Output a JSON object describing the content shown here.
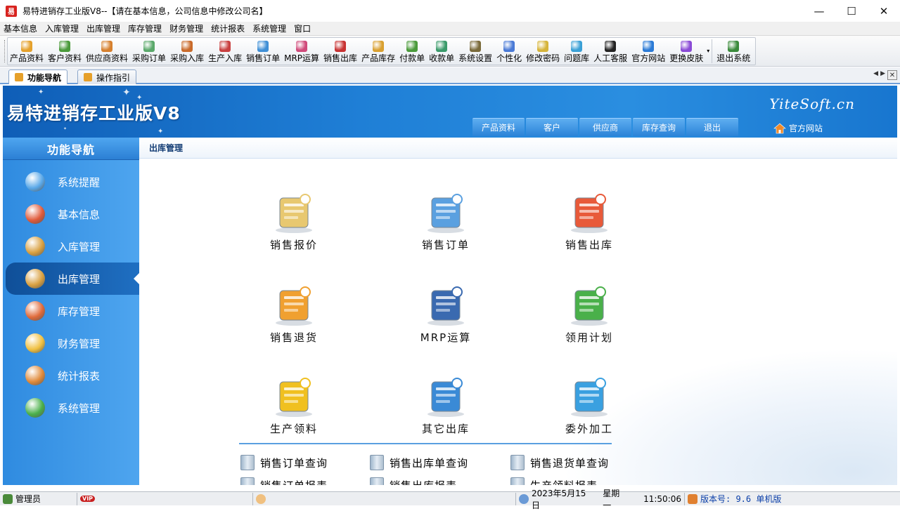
{
  "window": {
    "app_icon_text": "易",
    "title": "易特进销存工业版V8--【请在基本信息，公司信息中修改公司名】",
    "controls": [
      "—",
      "☐",
      "✕"
    ]
  },
  "menu": [
    "基本信息",
    "入库管理",
    "出库管理",
    "库存管理",
    "财务管理",
    "统计报表",
    "系统管理",
    "窗口"
  ],
  "toolbar": [
    {
      "label": "产品资料",
      "icon": "product-box-icon",
      "color": "#e5a12c"
    },
    {
      "label": "客户资料",
      "icon": "customer-icon",
      "color": "#4a9a3a"
    },
    {
      "label": "供应商资料",
      "icon": "supplier-icon",
      "color": "#d6802e"
    },
    {
      "label": "采购订单",
      "icon": "purchase-order-icon",
      "color": "#5aa86a"
    },
    {
      "label": "采购入库",
      "icon": "purchase-stock-in-icon",
      "color": "#c96a2a"
    },
    {
      "label": "生产入库",
      "icon": "production-stock-in-icon",
      "color": "#c94040"
    },
    {
      "label": "销售订单",
      "icon": "sales-order-icon",
      "color": "#3f8fd6"
    },
    {
      "label": "MRP运算",
      "icon": "mrp-calc-icon",
      "color": "#d04a7a"
    },
    {
      "label": "销售出库",
      "icon": "sales-stock-out-icon",
      "color": "#c83232"
    },
    {
      "label": "产品库存",
      "icon": "inventory-icon",
      "color": "#d9a030"
    },
    {
      "label": "付款单",
      "icon": "payment-icon",
      "color": "#4a9a3a"
    },
    {
      "label": "收款单",
      "icon": "receipt-icon",
      "color": "#3a9a6a"
    },
    {
      "label": "系统设置",
      "icon": "settings-icon",
      "color": "#7a6a3a"
    },
    {
      "label": "个性化",
      "icon": "personalize-icon",
      "color": "#4a7ad6"
    },
    {
      "label": "修改密码",
      "icon": "password-icon",
      "color": "#d6b43a"
    },
    {
      "label": "问题库",
      "icon": "faq-icon",
      "color": "#3aa0d6"
    },
    {
      "label": "人工客服",
      "icon": "qq-service-icon",
      "color": "#222222"
    },
    {
      "label": "官方网站",
      "icon": "ie-browser-icon",
      "color": "#2a7ad6"
    },
    {
      "label": "更换皮肤",
      "icon": "skin-icon",
      "color": "#8a4ad6"
    },
    {
      "label": "退出系统",
      "icon": "exit-icon",
      "color": "#3a8a3a"
    }
  ],
  "tabs": [
    {
      "label": "功能导航",
      "active": true
    },
    {
      "label": "操作指引",
      "active": false
    }
  ],
  "banner": {
    "brand": "易特进销存工业版V8",
    "site_name": "YiteSoft.cn",
    "nav_buttons": [
      "产品资料",
      "客户",
      "供应商",
      "库存查询",
      "退出"
    ],
    "home_link": "官方网站"
  },
  "sidebar": {
    "header": "功能导航",
    "items": [
      {
        "label": "系统提醒",
        "icon": "info-icon",
        "color": "#5aa8e8"
      },
      {
        "label": "基本信息",
        "icon": "cubes-icon",
        "color": "#e05a3a"
      },
      {
        "label": "入库管理",
        "icon": "stock-in-box-icon",
        "color": "#d9a040"
      },
      {
        "label": "出库管理",
        "icon": "stock-out-box-icon",
        "color": "#d9a040",
        "active": true
      },
      {
        "label": "库存管理",
        "icon": "warehouse-icon",
        "color": "#e06a3a"
      },
      {
        "label": "财务管理",
        "icon": "coins-icon",
        "color": "#f0c040"
      },
      {
        "label": "统计报表",
        "icon": "report-icon",
        "color": "#e08a3a"
      },
      {
        "label": "系统管理",
        "icon": "bar-chart-icon",
        "color": "#4ab04a"
      }
    ]
  },
  "main": {
    "breadcrumb": "出库管理",
    "tiles": [
      {
        "label": "销售报价",
        "icon": "sales-quote-icon",
        "color": "#e8c870"
      },
      {
        "label": "销售订单",
        "icon": "sales-order-icon",
        "color": "#5aa0e0"
      },
      {
        "label": "销售出库",
        "icon": "sales-delivery-icon",
        "color": "#e85a3a"
      },
      {
        "label": "销售退货",
        "icon": "sales-return-truck-icon",
        "color": "#f0a030"
      },
      {
        "label": "MRP运算",
        "icon": "mrp-calculator-icon",
        "color": "#3a6ab0"
      },
      {
        "label": "领用计划",
        "icon": "requisition-plan-icon",
        "color": "#4ab04a"
      },
      {
        "label": "生产领料",
        "icon": "production-material-basket-icon",
        "color": "#f0c020"
      },
      {
        "label": "其它出库",
        "icon": "other-outbound-house-icon",
        "color": "#3a8ad6"
      },
      {
        "label": "委外加工",
        "icon": "outsourcing-basket-icon",
        "color": "#3aa0e0"
      }
    ],
    "query_links": [
      "销售订单查询",
      "销售出库单查询",
      "销售退货单查询"
    ],
    "query_links_row2": [
      "销售订单报表",
      "销售出库报表",
      "生产领料报表"
    ]
  },
  "status": {
    "user": "管理员",
    "vip": "VIP",
    "date": "2023年5月15日",
    "weekday": "星期一",
    "time": "11:50:06",
    "version": "版本号: 9.6 单机版"
  }
}
